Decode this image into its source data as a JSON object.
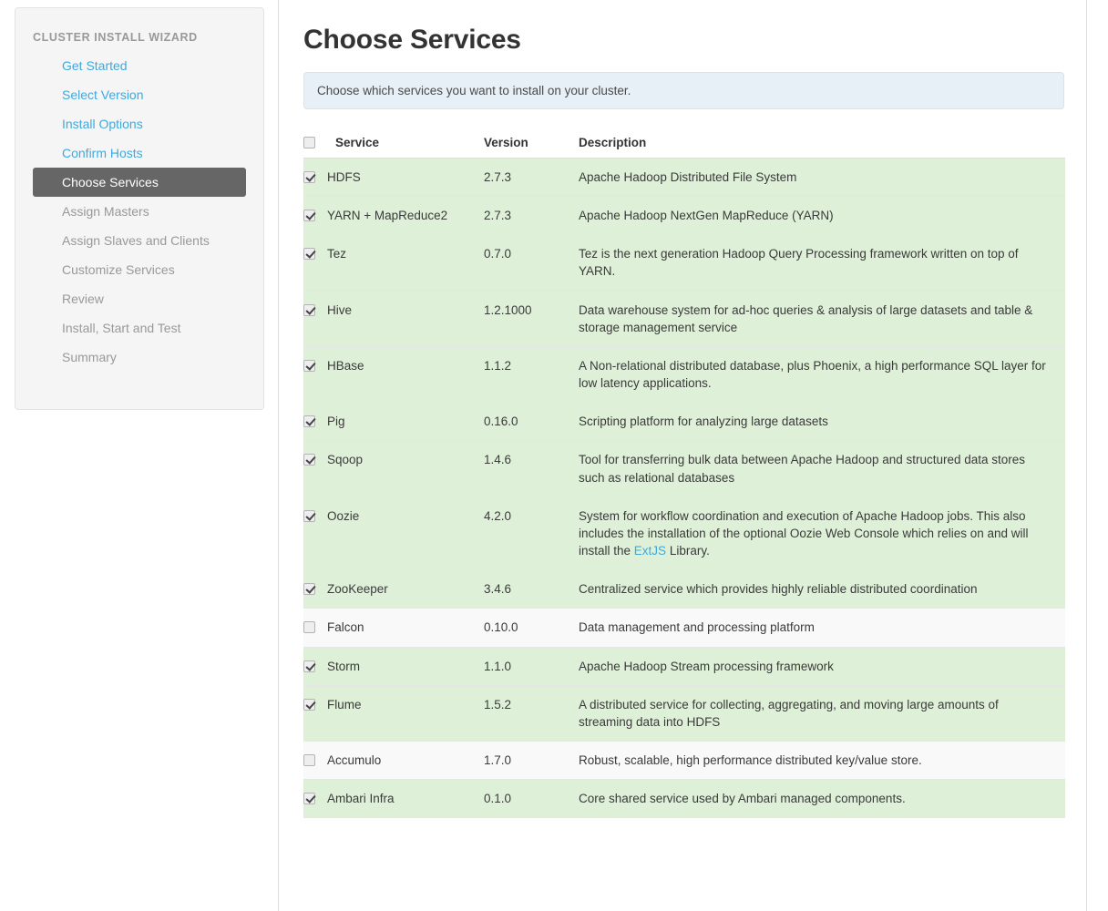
{
  "sidebar": {
    "title": "CLUSTER INSTALL WIZARD",
    "items": [
      {
        "label": "Get Started",
        "state": "done"
      },
      {
        "label": "Select Version",
        "state": "done"
      },
      {
        "label": "Install Options",
        "state": "done"
      },
      {
        "label": "Confirm Hosts",
        "state": "done"
      },
      {
        "label": "Choose Services",
        "state": "active"
      },
      {
        "label": "Assign Masters",
        "state": "pending"
      },
      {
        "label": "Assign Slaves and Clients",
        "state": "pending"
      },
      {
        "label": "Customize Services",
        "state": "pending"
      },
      {
        "label": "Review",
        "state": "pending"
      },
      {
        "label": "Install, Start and Test",
        "state": "pending"
      },
      {
        "label": "Summary",
        "state": "pending"
      }
    ]
  },
  "main": {
    "title": "Choose Services",
    "info_banner": "Choose which services you want to install on your cluster.",
    "table": {
      "select_all_checked": false,
      "headers": {
        "service": "Service",
        "version": "Version",
        "description": "Description"
      },
      "rows": [
        {
          "checked": true,
          "name": "HDFS",
          "version": "2.7.3",
          "description": "Apache Hadoop Distributed File System"
        },
        {
          "checked": true,
          "name": "YARN + MapReduce2",
          "version": "2.7.3",
          "description": "Apache Hadoop NextGen MapReduce (YARN)"
        },
        {
          "checked": true,
          "name": "Tez",
          "version": "0.7.0",
          "description": "Tez is the next generation Hadoop Query Processing framework written on top of YARN."
        },
        {
          "checked": true,
          "name": "Hive",
          "version": "1.2.1000",
          "description": "Data warehouse system for ad-hoc queries & analysis of large datasets and table & storage management service"
        },
        {
          "checked": true,
          "name": "HBase",
          "version": "1.1.2",
          "description": "A Non-relational distributed database, plus Phoenix, a high performance SQL layer for low latency applications."
        },
        {
          "checked": true,
          "name": "Pig",
          "version": "0.16.0",
          "description": "Scripting platform for analyzing large datasets"
        },
        {
          "checked": true,
          "name": "Sqoop",
          "version": "1.4.6",
          "description": "Tool for transferring bulk data between Apache Hadoop and structured data stores such as relational databases"
        },
        {
          "checked": true,
          "name": "Oozie",
          "version": "4.2.0",
          "description_before_link": "System for workflow coordination and execution of Apache Hadoop jobs. This also includes the installation of the optional Oozie Web Console which relies on and will install the ",
          "description_link": "ExtJS",
          "description_after_link": " Library."
        },
        {
          "checked": true,
          "name": "ZooKeeper",
          "version": "3.4.6",
          "description": "Centralized service which provides highly reliable distributed coordination"
        },
        {
          "checked": false,
          "name": "Falcon",
          "version": "0.10.0",
          "description": "Data management and processing platform"
        },
        {
          "checked": true,
          "name": "Storm",
          "version": "1.1.0",
          "description": "Apache Hadoop Stream processing framework"
        },
        {
          "checked": true,
          "name": "Flume",
          "version": "1.5.2",
          "description": "A distributed service for collecting, aggregating, and moving large amounts of streaming data into HDFS"
        },
        {
          "checked": false,
          "name": "Accumulo",
          "version": "1.7.0",
          "description": "Robust, scalable, high performance distributed key/value store."
        },
        {
          "checked": true,
          "name": "Ambari Infra",
          "version": "0.1.0",
          "description": "Core shared service used by Ambari managed components."
        }
      ]
    }
  },
  "colors": {
    "link": "#3fa9dd",
    "active_nav_bg": "#666666",
    "row_selected_bg": "#dff0d8",
    "row_unselected_bg": "#f9f9f9",
    "banner_bg": "#e7f0f6"
  }
}
